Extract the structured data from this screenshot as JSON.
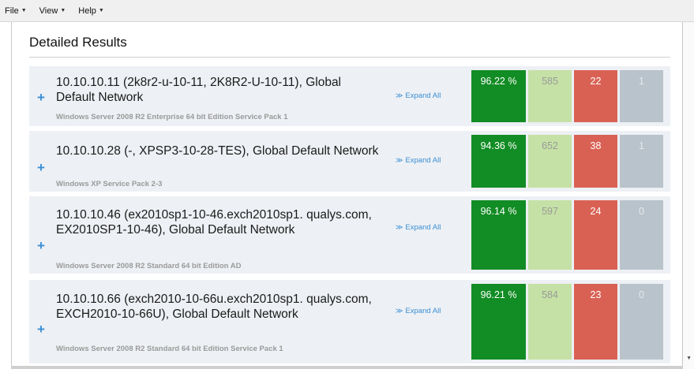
{
  "menu": {
    "file": "File",
    "view": "View",
    "help": "Help"
  },
  "page": {
    "title": "Detailed Results"
  },
  "rows": [
    {
      "host": "10.10.10.11 (2k8r2-u-10-11, 2K8R2-U-10-11), Global Default Network",
      "os": "Windows Server 2008 R2 Enterprise 64 bit Edition Service Pack 1",
      "expand": "Expand All",
      "percent": "96.22 %",
      "passed": "585",
      "failed": "22",
      "other": "1"
    },
    {
      "host": "10.10.10.28 (-, XPSP3-10-28-TES), Global Default Network",
      "os": "Windows XP Service Pack 2-3",
      "expand": "Expand All",
      "percent": "94.36 %",
      "passed": "652",
      "failed": "38",
      "other": "1"
    },
    {
      "host": "10.10.10.46 (ex2010sp1-10-46.exch2010sp1. qualys.com, EX2010SP1-10-46), Global Default Network",
      "os": "Windows Server 2008 R2 Standard 64 bit Edition AD",
      "expand": "Expand All",
      "percent": "96.14 %",
      "passed": "597",
      "failed": "24",
      "other": "0"
    },
    {
      "host": "10.10.10.66 (exch2010-10-66u.exch2010sp1. qualys.com, EXCH2010-10-66U), Global Default Network",
      "os": "Windows Server 2008 R2 Standard 64 bit Edition Service Pack 1",
      "expand": "Expand All",
      "percent": "96.21 %",
      "passed": "584",
      "failed": "23",
      "other": "0"
    }
  ],
  "colors": {
    "percent_box": "#128c24",
    "passed_box": "#c5e1a5",
    "failed_box": "#d96154",
    "other_box": "#b9c3cb",
    "accent": "#3a8fd6"
  },
  "icons": {
    "expand_row": "plus-icon",
    "expand_all": "double-chevron-down-icon",
    "menu_caret": "caret-down-icon"
  }
}
